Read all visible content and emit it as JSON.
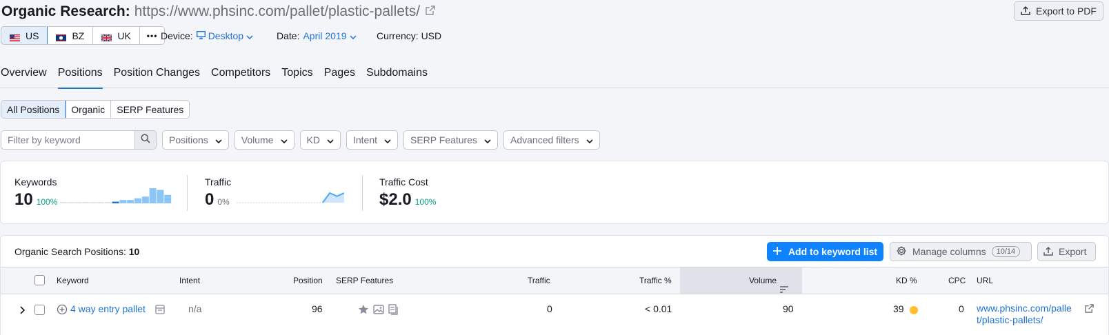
{
  "header": {
    "title": "Organic Research:",
    "url": "https://www.phsinc.com/pallet/plastic-pallets/",
    "export_pdf": "Export to PDF"
  },
  "databases": [
    {
      "code": "US",
      "active": true
    },
    {
      "code": "BZ",
      "active": false
    },
    {
      "code": "UK",
      "active": false
    }
  ],
  "more_label": "•••",
  "device": {
    "label": "Device:",
    "value": "Desktop"
  },
  "date": {
    "label": "Date:",
    "value": "April 2019"
  },
  "currency": {
    "label": "Currency: USD"
  },
  "tabs": [
    "Overview",
    "Positions",
    "Position Changes",
    "Competitors",
    "Topics",
    "Pages",
    "Subdomains"
  ],
  "segments": [
    "All Positions",
    "Organic",
    "SERP Features"
  ],
  "filters": {
    "search_placeholder": "Filter by keyword",
    "dropdowns": [
      "Positions",
      "Volume",
      "KD",
      "Intent",
      "SERP Features",
      "Advanced filters"
    ]
  },
  "summary": {
    "keywords": {
      "label": "Keywords",
      "value": "10",
      "pct": "100%",
      "trend": [
        0,
        0,
        0,
        0,
        0,
        0,
        0,
        1,
        2,
        2,
        3,
        4,
        9,
        8,
        5
      ]
    },
    "traffic": {
      "label": "Traffic",
      "value": "0",
      "pct": "0%",
      "trend": [
        0,
        0,
        0,
        0,
        0,
        0,
        0,
        0,
        0,
        0,
        0,
        0,
        0,
        3,
        2,
        3
      ]
    },
    "traffic_cost": {
      "label": "Traffic Cost",
      "value": "$2.0",
      "pct": "100%"
    }
  },
  "table": {
    "title": "Organic Search Positions:",
    "count": "10",
    "add_button": "Add to keyword list",
    "manage_columns": "Manage columns",
    "columns_count": "10/14",
    "export": "Export",
    "headers": {
      "keyword": "Keyword",
      "intent": "Intent",
      "position": "Position",
      "serp": "SERP Features",
      "traffic": "Traffic",
      "traffic_pct": "Traffic %",
      "volume": "Volume",
      "kd": "KD %",
      "cpc": "CPC",
      "url": "URL"
    },
    "rows": [
      {
        "keyword": "4 way entry pallet",
        "intent": "n/a",
        "position": "96",
        "traffic": "0",
        "traffic_pct": "< 0.01",
        "volume": "90",
        "kd": "39",
        "cpc": "0",
        "url_line1": "www.phsinc.com/palle",
        "url_line2": "t/plastic-pallets/"
      }
    ]
  },
  "colors": {
    "accent": "#2072d8",
    "primary_button": "#0f83ff",
    "kd_dot": "#ffbe2f",
    "positive": "#009f81",
    "chart_blue": "#4fa8f5"
  }
}
